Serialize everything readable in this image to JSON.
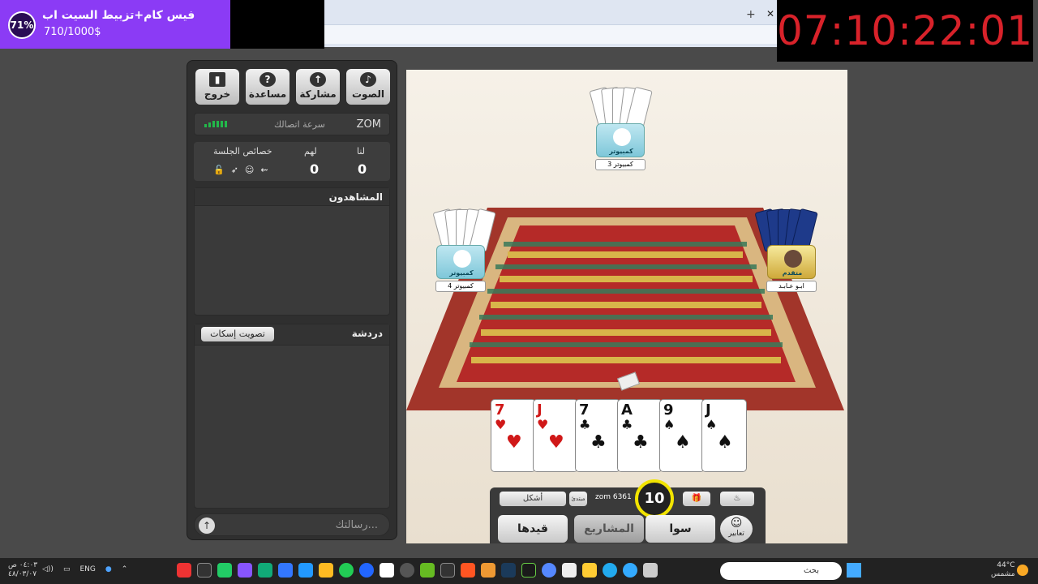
{
  "promo": {
    "percent": "71%",
    "title": "فيس كام+تزبيط السيت اب",
    "progress": "710/1000$"
  },
  "timer": "07:10:22:01",
  "browser": {
    "new_tab": "+",
    "close_tab": "✕"
  },
  "toolbar": {
    "sound": "الصوت",
    "share": "مشاركة",
    "help": "مساعدة",
    "exit": "خروج"
  },
  "connection": {
    "username": "ZOM",
    "speed_label": "سرعة اتصالك"
  },
  "score": {
    "us_label": "لنا",
    "them_label": "لهم",
    "props_label": "خصائص الجلسة",
    "us": "0",
    "them": "0"
  },
  "spectators_title": "المشاهدون",
  "chat": {
    "title": "دردشة",
    "mute_button": "تصويت إسكات",
    "placeholder": "رسالتك..."
  },
  "players": {
    "top": {
      "role": "كمبيوتر",
      "name": "كمبيوتر 3"
    },
    "left": {
      "role": "كمبيوتر",
      "name": "كمبيوتر 4"
    },
    "right": {
      "role": "متقدم",
      "name": "ابـو عـابـد"
    }
  },
  "hand": [
    {
      "rank": "7",
      "suit": "♥",
      "color": "red"
    },
    {
      "rank": "J",
      "suit": "♥",
      "color": "red"
    },
    {
      "rank": "7",
      "suit": "♣",
      "color": "black"
    },
    {
      "rank": "A",
      "suit": "♣",
      "color": "black"
    },
    {
      "rank": "9",
      "suit": "♠",
      "color": "black"
    },
    {
      "rank": "J",
      "suit": "♠",
      "color": "black"
    }
  ],
  "hud": {
    "shapes": "أشكل",
    "level_badge": "مبتدئ",
    "user_tag": "zom 6361",
    "countdown": "10",
    "btn_qaidha": "قيدها",
    "btn_mashari": "المشاريع",
    "btn_sawa": "سوا",
    "btn_emotes": "تعابير"
  },
  "taskbar": {
    "time": "٠٤:٠٣ ص",
    "date": "٤٨/٠٣/٠٧",
    "lang": "ENG",
    "search": "بحث",
    "temp": "44°C",
    "weather": "مشمس"
  }
}
